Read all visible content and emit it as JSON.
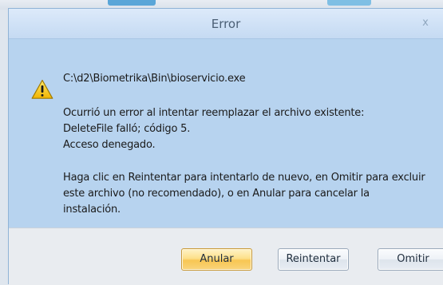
{
  "window": {
    "title": "Error",
    "close_glyph": "x"
  },
  "message": {
    "icon": "warning-icon",
    "path": "C:\\d2\\Biometrika\\Bin\\bioservicio.exe",
    "error_line_1": "Ocurrió un error al intentar reemplazar el archivo existente:",
    "error_line_2": "DeleteFile falló; código 5.",
    "error_line_3": "Acceso denegado.",
    "help_line_1": "Haga clic en Reintentar para intentarlo de nuevo, en Omitir para excluir",
    "help_line_2": "este archivo (no recomendado), o en Anular para cancelar la",
    "help_line_3": "instalación."
  },
  "buttons": {
    "abort_label": "Anular",
    "retry_label": "Reintentar",
    "skip_label": "Omitir"
  },
  "colors": {
    "content_background": "#b7d3ef",
    "footer_background": "#e9ecf0",
    "default_button": "#f8c653",
    "warning_yellow": "#f5c400"
  }
}
